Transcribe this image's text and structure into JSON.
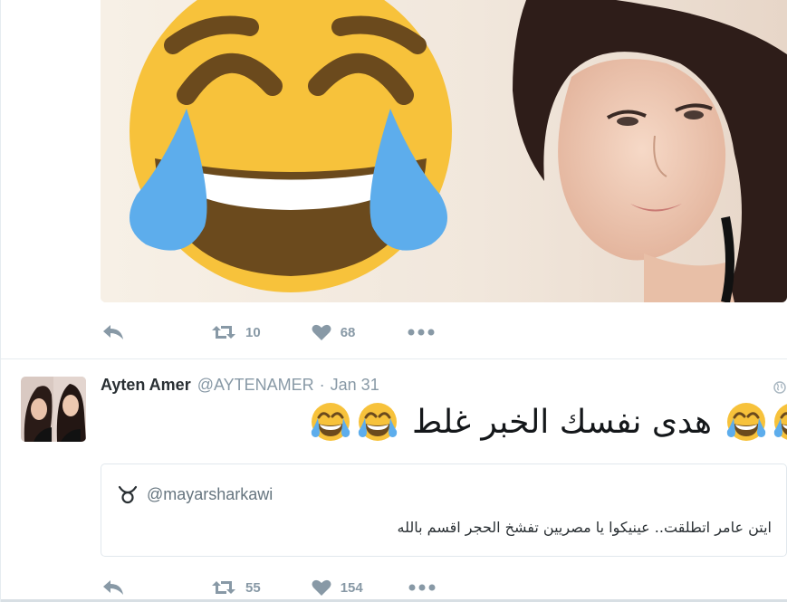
{
  "tweets": [
    {
      "media": {
        "alt_icon": "face-with-tears-of-joy-image"
      },
      "actions": {
        "reply_icon": "reply-icon",
        "retweet_count": "10",
        "like_count": "68",
        "more_icon": "more-icon"
      }
    },
    {
      "author": {
        "fullname": "Ayten Amer",
        "username": "@AYTENAMER",
        "separator": "·",
        "time": "Jan 31"
      },
      "text": "هدى نفسك الخبر غلط",
      "quote": {
        "username": "@mayarsharkawi",
        "text": "ايتن عامر اتطلقت.. عينيكوا يا مصريين تفشخ الحجر اقسم بالله"
      },
      "actions": {
        "retweet_count": "55",
        "like_count": "154"
      }
    }
  ],
  "colors": {
    "icon_gray": "#8899a6",
    "emoji_yellow": "#f7c23b",
    "tear_blue": "#5dadec",
    "border": "#e1e8ed"
  }
}
